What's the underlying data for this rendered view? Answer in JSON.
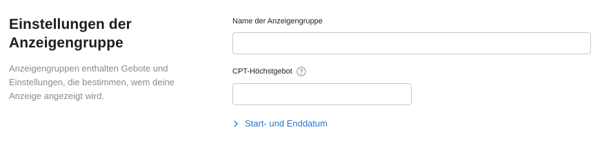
{
  "left": {
    "title": "Einstellungen der Anzeigengruppe",
    "description": "Anzeigengruppen enthalten Gebote und Einstellungen, die bestimmen, wem deine Anzeige angezeigt wird."
  },
  "form": {
    "name_label": "Name der Anzeigengruppe",
    "name_value": "",
    "cpt_label": "CPT-Höchstgebot",
    "cpt_value": "",
    "date_toggle_label": "Start- und Enddatum"
  },
  "icons": {
    "help": "question-circle-icon",
    "toggle": "chevron-right-icon"
  },
  "colors": {
    "accent": "#2a73d2",
    "muted_text": "#8a8a8e",
    "border": "#c9c9cc"
  }
}
